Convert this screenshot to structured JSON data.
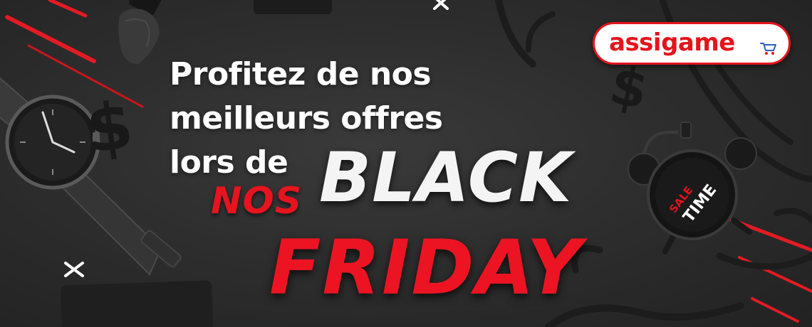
{
  "headline": {
    "line1": "Profitez de nos",
    "line2": "meilleurs offres",
    "line3": "lors de"
  },
  "promo": {
    "word_nos": "NOS",
    "word_black": "BLACK",
    "word_friday": "FRIDAY"
  },
  "logo": {
    "text": "assigame"
  },
  "clock": {
    "sale_label": "SALE",
    "time_label": "TIME"
  },
  "colors": {
    "accent_red": "#e4141d",
    "text_white": "#ffffff",
    "background": "#2b2b2b"
  },
  "icons": [
    "cart-icon",
    "dollar-sign-icon",
    "wristwatch-icon",
    "alarm-clock-icon",
    "makeup-brush-icon",
    "plus-mark-icon"
  ]
}
